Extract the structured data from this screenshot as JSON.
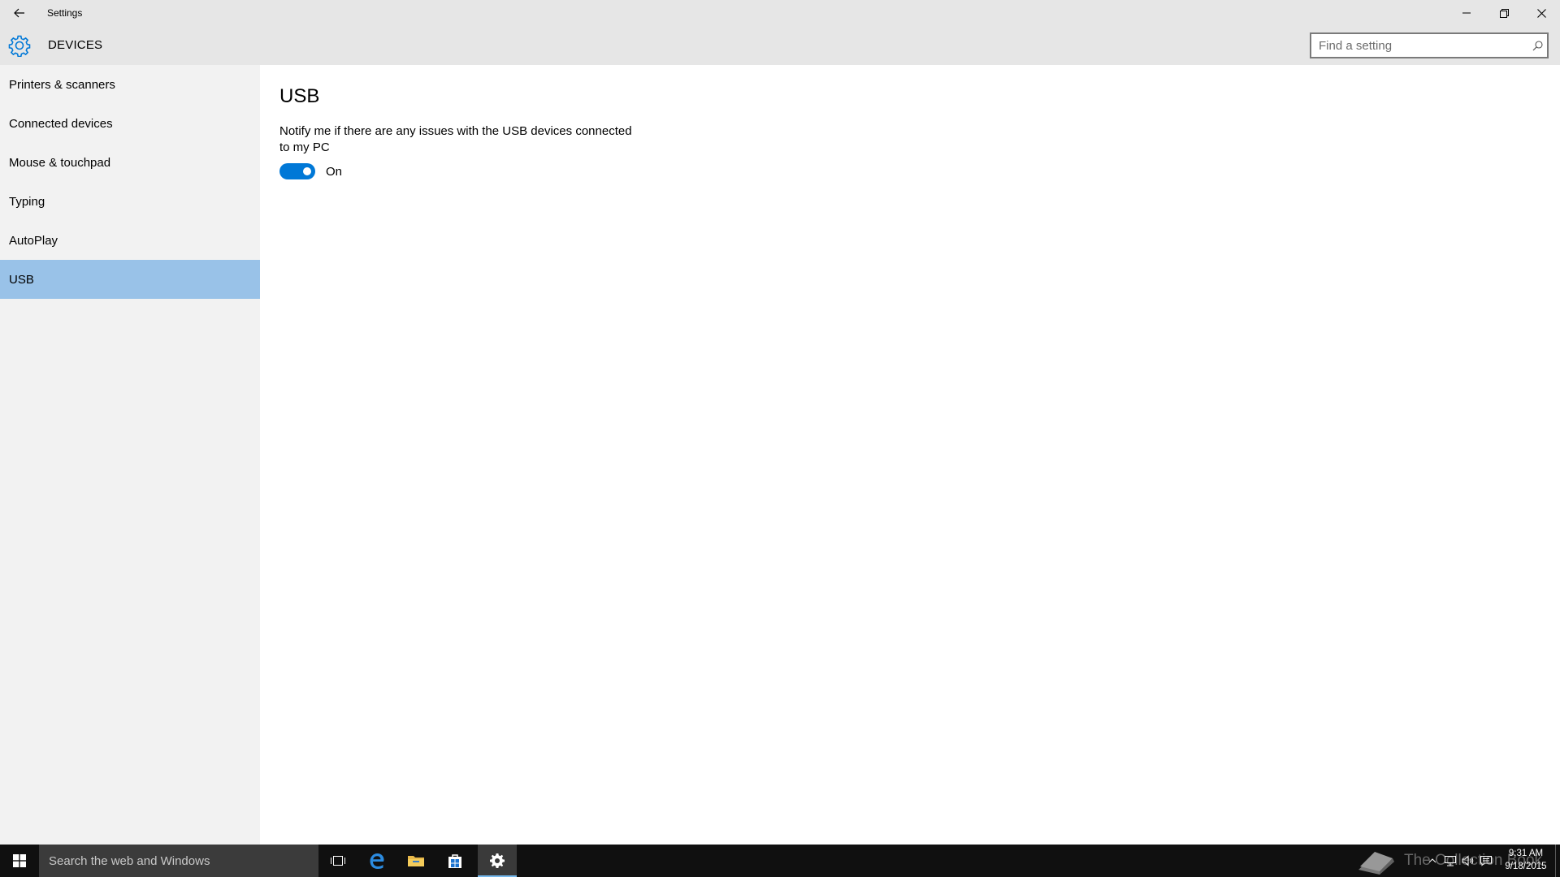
{
  "window": {
    "title": "Settings"
  },
  "header": {
    "title": "DEVICES",
    "search_placeholder": "Find a setting"
  },
  "sidebar": {
    "items": [
      {
        "label": "Printers & scanners",
        "selected": false
      },
      {
        "label": "Connected devices",
        "selected": false
      },
      {
        "label": "Mouse & touchpad",
        "selected": false
      },
      {
        "label": "Typing",
        "selected": false
      },
      {
        "label": "AutoPlay",
        "selected": false
      },
      {
        "label": "USB",
        "selected": true
      }
    ]
  },
  "main": {
    "title": "USB",
    "notify_text": "Notify me if there are any issues with the USB devices connected to my PC",
    "toggle": {
      "state": "on",
      "label": "On"
    }
  },
  "taskbar": {
    "search_placeholder": "Search the web and Windows",
    "watermark": "The Collection Book",
    "clock": {
      "time": "9:31 AM",
      "date": "9/18/2015"
    }
  },
  "colors": {
    "accent": "#0078d7",
    "selected_item": "#99c2e8",
    "header_bg": "#e6e6e6",
    "sidebar_bg": "#f2f2f2",
    "taskbar_bg": "#101010"
  },
  "icons": {
    "back": "back-arrow-icon",
    "header": "gear-icon",
    "search": "search-icon",
    "minimize": "minimize-icon",
    "maximize": "restore-icon",
    "close": "close-icon"
  }
}
